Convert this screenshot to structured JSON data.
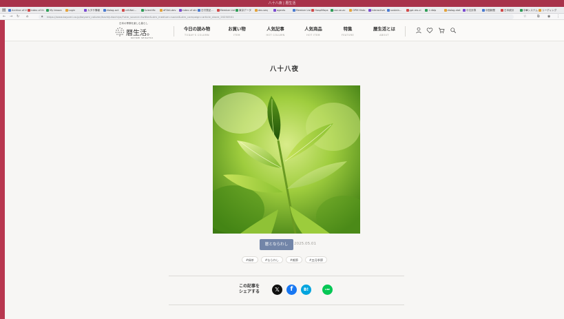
{
  "browser": {
    "window_title": "八十八夜 | 暦生活",
    "bookmarks": [
      "Archive of th",
      "index of th",
      "My lesson",
      "Login",
      "カタサ情報",
      "dialog-act",
      "rdf-Wal...",
      "Scientific",
      "dFDAI-dev",
      "index of stn",
      "日付表記...",
      "Member List",
      "東京データ",
      "dev-seq",
      "agents",
      "Member List",
      "HospiMaps",
      "cse-se-ac",
      "OPM Histo",
      "Interactive",
      "sustain...",
      "gpt-res-cl",
      "1 dblp",
      "dialog-stat",
      "中文計算",
      "中国新聞",
      "日本統計",
      "中華システム",
      "リーディング"
    ],
    "url": "https://www.koyomi.co.jp/koyomi_column/hachijuhachiya/?utm_source=twitter&utm_medium=social&utm_campaign=article_share_20250501"
  },
  "site": {
    "tagline": "日本の季節を楽しむ暮らし",
    "logo_name": "暦生活。",
    "logo_sub": "KOYOMI SEIKATSU",
    "nav": [
      {
        "jp": "今日の読み物",
        "en": "TODAY'S COLUMN"
      },
      {
        "jp": "お買い物",
        "en": "ITEM"
      },
      {
        "jp": "人気記事",
        "en": "HOT COLUMN"
      },
      {
        "jp": "人気商品",
        "en": "HOT ITEM"
      },
      {
        "jp": "特集",
        "en": "FEATURE"
      },
      {
        "jp": "暦生活とは",
        "en": "ABOUT"
      }
    ],
    "icons": [
      "user-icon",
      "heart-icon",
      "cart-icon",
      "search-icon"
    ]
  },
  "article": {
    "title": "八十八夜",
    "category": "暦とならわし",
    "date": "2025.05.01",
    "tags": [
      "#緑茶",
      "#ならわし",
      "#雑節",
      "#五月季節"
    ],
    "image_alt": "green tea leaves"
  },
  "share": {
    "line1": "この記事を",
    "line2": "シェアする",
    "buttons": [
      {
        "label": "𝕏",
        "color": "#111111",
        "icon": "x-icon"
      },
      {
        "label": "f",
        "color": "#1877f2",
        "icon": "facebook-icon"
      },
      {
        "label": "B!",
        "color": "#00a4de",
        "icon": "hatena-icon"
      },
      {
        "label": "LINE",
        "color": "#06c755",
        "icon": "line-icon"
      }
    ]
  },
  "colors": {
    "accent": "#7285a8",
    "frame": "#b8374f"
  }
}
